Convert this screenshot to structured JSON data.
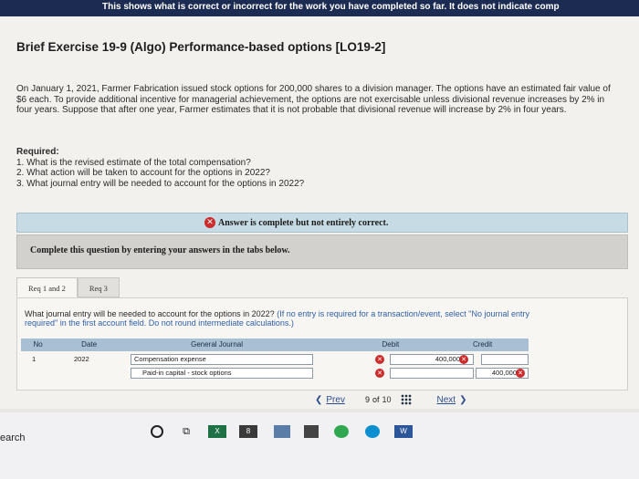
{
  "top_bar": {
    "text": "This shows what is correct or incorrect for the work you have completed so far. It does not indicate comp"
  },
  "exercise": {
    "title": "Brief Exercise 19-9 (Algo) Performance-based options [LO19-2]",
    "intro": "On January 1, 2021, Farmer Fabrication issued stock options for 200,000 shares to a division manager. The options have an estimated fair value of $6 each. To provide additional incentive for managerial achievement, the options are not exercisable unless divisional revenue increases by 2% in four years. Suppose that after one year, Farmer estimates that it is not probable that divisional revenue will increase by 2% in four years.",
    "required_heading": "Required:",
    "required_items": [
      "1. What is the revised estimate of the total compensation?",
      "2. What action will be taken to account for the options in 2022?",
      "3. What journal entry will be needed to account for the options in 2022?"
    ]
  },
  "answer_status": "Answer is complete but not entirely correct.",
  "instructions": "Complete this question by entering your answers in the tabs below.",
  "tabs": [
    {
      "label": "Req 1 and 2",
      "active": true
    },
    {
      "label": "Req 3",
      "active": false
    }
  ],
  "question": {
    "text": "What journal entry will be needed to account for the options in 2022?",
    "hint": "(If no entry is required for a transaction/event, select \"No journal entry required\" in the first account field. Do not round intermediate calculations.)"
  },
  "journal": {
    "headers": {
      "no": "No",
      "date": "Date",
      "account": "General Journal",
      "debit": "Debit",
      "credit": "Credit"
    },
    "rows": [
      {
        "no": "1",
        "date": "2022",
        "account": "Compensation expense",
        "debit": "400,000",
        "credit": ""
      },
      {
        "no": "",
        "date": "",
        "account": "Paid-in capital - stock options",
        "debit": "",
        "credit": "400,000"
      }
    ]
  },
  "pager": {
    "prev": "Prev",
    "page": "9",
    "of": "of",
    "total": "10",
    "next": "Next"
  },
  "taskbar": {
    "search_text": "earch",
    "badge": "8"
  },
  "colors": {
    "incorrect": "#cc2b2b",
    "banner": "#c7dbe4",
    "table_header": "#a9bfd3",
    "link": "#2b4d8f"
  }
}
